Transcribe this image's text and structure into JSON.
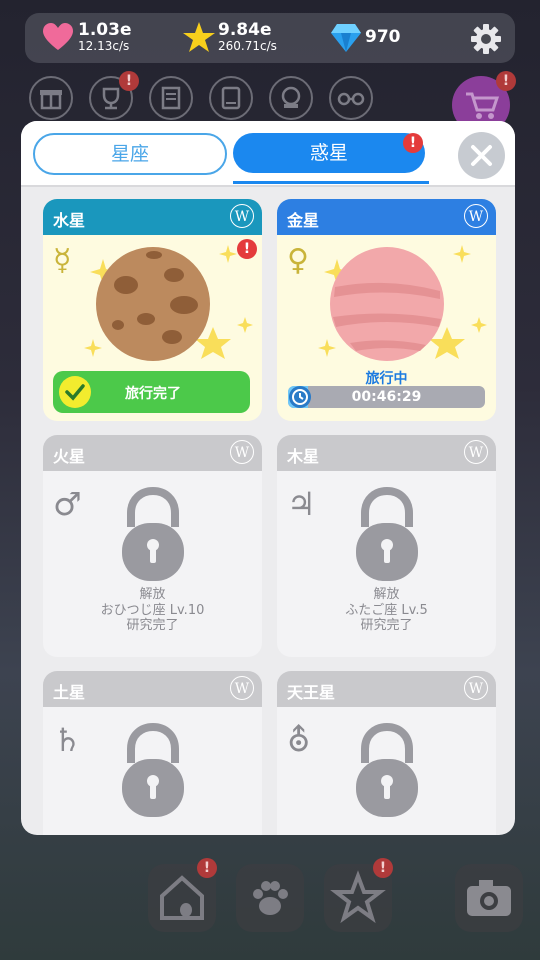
{
  "hud": {
    "hearts": "1.03e",
    "hearts_rate": "12.13c/s",
    "stars": "9.84e",
    "stars_rate": "260.71c/s",
    "gems": "970"
  },
  "tabs": [
    {
      "label": "星座",
      "active": false
    },
    {
      "label": "惑星",
      "active": true
    }
  ],
  "alert_mark": "!",
  "wiki_mark": "W",
  "cards": [
    {
      "name": "水星",
      "symbol": "☿",
      "status": "completed",
      "button_label": "旅行完了",
      "head_color": "#1a97bd"
    },
    {
      "name": "金星",
      "symbol": "♀",
      "status": "traveling",
      "travel_label": "旅行中",
      "time": "00:46:29",
      "progress": 0.1,
      "head_color": "#2d7fe2"
    },
    {
      "name": "火星",
      "symbol": "♂",
      "status": "locked",
      "unlock_line1": "解放",
      "unlock_line2": "おひつじ座 Lv.10",
      "unlock_line3": "研究完了"
    },
    {
      "name": "木星",
      "symbol": "♃",
      "status": "locked",
      "unlock_line1": "解放",
      "unlock_line2": "ふたご座 Lv.5",
      "unlock_line3": "研究完了"
    },
    {
      "name": "土星",
      "symbol": "♄",
      "status": "locked"
    },
    {
      "name": "天王星",
      "symbol": "⛢",
      "status": "locked"
    }
  ],
  "colors": {
    "accent": "#1b88ef",
    "locked_head": "#c9c9cc",
    "complete": "#4cc94a"
  }
}
